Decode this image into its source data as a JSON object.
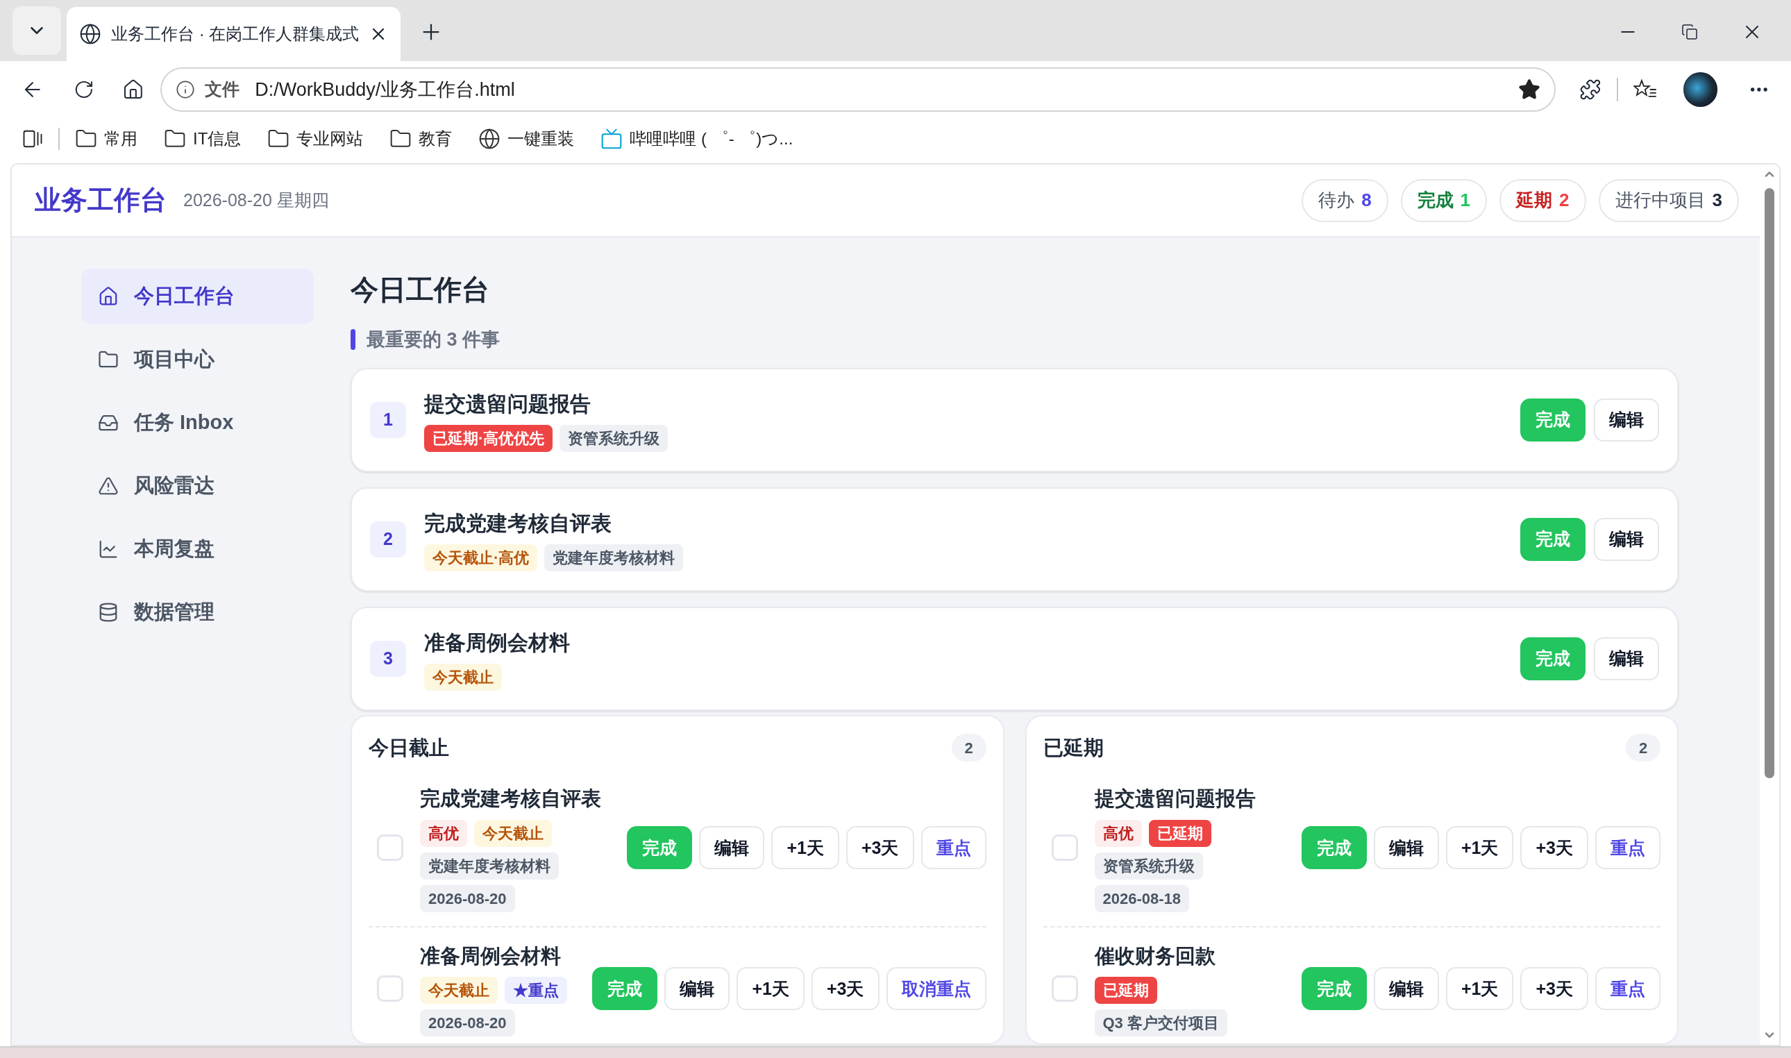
{
  "browser": {
    "tabs": [
      {
        "title": "业务工作台 · 在岗工作人群集成式",
        "selected": true
      }
    ],
    "address": {
      "scheme": "文件",
      "url": "D:/WorkBuddy/业务工作台.html"
    },
    "bookmarks": [
      {
        "label": "常用",
        "kind": "folder"
      },
      {
        "label": "IT信息",
        "kind": "folder"
      },
      {
        "label": "专业网站",
        "kind": "folder"
      },
      {
        "label": "教育",
        "kind": "folder"
      },
      {
        "label": "一键重装",
        "kind": "globe"
      },
      {
        "label": "哔哩哔哩 ( ゜- ゜)つ...",
        "kind": "tv"
      }
    ]
  },
  "header": {
    "brand": "业务工作台",
    "date": "2026-08-20 星期四",
    "stats": [
      {
        "label": "待办",
        "value": "8",
        "kind": "todo"
      },
      {
        "label": "完成",
        "value": "1",
        "kind": "done"
      },
      {
        "label": "延期",
        "value": "2",
        "kind": "late"
      },
      {
        "label": "进行中项目",
        "value": "3",
        "kind": "project"
      }
    ]
  },
  "sidebar": {
    "items": [
      {
        "label": "今日工作台",
        "selected": true
      },
      {
        "label": "项目中心",
        "selected": false
      },
      {
        "label": "任务 Inbox",
        "selected": false
      },
      {
        "label": "风险雷达",
        "selected": false
      },
      {
        "label": "本周复盘",
        "selected": false
      },
      {
        "label": "数据管理",
        "selected": false
      }
    ]
  },
  "main": {
    "title": "今日工作台",
    "section_title": "最重要的 3 件事",
    "top_tasks": [
      {
        "number": "1",
        "title": "提交遗留问题报告",
        "tags": [
          {
            "text": "已延期·高优优先",
            "kind": "late"
          },
          {
            "text": "资管系统升级",
            "kind": "project"
          }
        ],
        "buttons": [
          {
            "label": "完成",
            "kind": "done"
          },
          {
            "label": "编辑",
            "kind": "plain"
          }
        ]
      },
      {
        "number": "2",
        "title": "完成党建考核自评表",
        "tags": [
          {
            "text": "今天截止·高优",
            "kind": "today"
          },
          {
            "text": "党建年度考核材料",
            "kind": "project"
          }
        ],
        "buttons": [
          {
            "label": "完成",
            "kind": "done"
          },
          {
            "label": "编辑",
            "kind": "plain"
          }
        ]
      },
      {
        "number": "3",
        "title": "准备周例会材料",
        "tags": [
          {
            "text": "今天截止",
            "kind": "today"
          }
        ],
        "buttons": [
          {
            "label": "完成",
            "kind": "done"
          },
          {
            "label": "编辑",
            "kind": "plain"
          }
        ]
      }
    ]
  },
  "lists": [
    {
      "title": "今日截止",
      "count": "2",
      "items": [
        {
          "title": "完成党建考核自评表",
          "checked": false,
          "tags": [
            {
              "text": "高优",
              "kind": "high"
            },
            {
              "text": "今天截止",
              "kind": "today"
            }
          ],
          "project": "党建年度考核材料",
          "date": "2026-08-20",
          "buttons": [
            {
              "label": "完成",
              "kind": "done"
            },
            {
              "label": "编辑",
              "kind": "plain"
            },
            {
              "label": "+1天",
              "kind": "plain"
            },
            {
              "label": "+3天",
              "kind": "plain"
            },
            {
              "label": "重点",
              "kind": "accent"
            }
          ]
        },
        {
          "title": "准备周例会材料",
          "checked": false,
          "tags": [
            {
              "text": "今天截止",
              "kind": "today"
            },
            {
              "text": "★重点",
              "kind": "focus"
            }
          ],
          "date": "2026-08-20",
          "buttons": [
            {
              "label": "完成",
              "kind": "done"
            },
            {
              "label": "编辑",
              "kind": "plain"
            },
            {
              "label": "+1天",
              "kind": "plain"
            },
            {
              "label": "+3天",
              "kind": "plain"
            },
            {
              "label": "取消重点",
              "kind": "accent"
            }
          ]
        }
      ]
    },
    {
      "title": "已延期",
      "count": "2",
      "items": [
        {
          "title": "提交遗留问题报告",
          "checked": false,
          "tags": [
            {
              "text": "高优",
              "kind": "high"
            },
            {
              "text": "已延期",
              "kind": "late"
            }
          ],
          "project": "资管系统升级",
          "date": "2026-08-18",
          "buttons": [
            {
              "label": "完成",
              "kind": "done"
            },
            {
              "label": "编辑",
              "kind": "plain"
            },
            {
              "label": "+1天",
              "kind": "plain"
            },
            {
              "label": "+3天",
              "kind": "plain"
            },
            {
              "label": "重点",
              "kind": "accent"
            }
          ]
        },
        {
          "title": "催收财务回款",
          "checked": false,
          "tags": [
            {
              "text": "已延期",
              "kind": "late"
            }
          ],
          "project": "Q3 客户交付项目",
          "buttons": [
            {
              "label": "完成",
              "kind": "done"
            },
            {
              "label": "编辑",
              "kind": "plain"
            },
            {
              "label": "+1天",
              "kind": "plain"
            },
            {
              "label": "+3天",
              "kind": "plain"
            },
            {
              "label": "重点",
              "kind": "accent"
            }
          ]
        }
      ]
    }
  ]
}
